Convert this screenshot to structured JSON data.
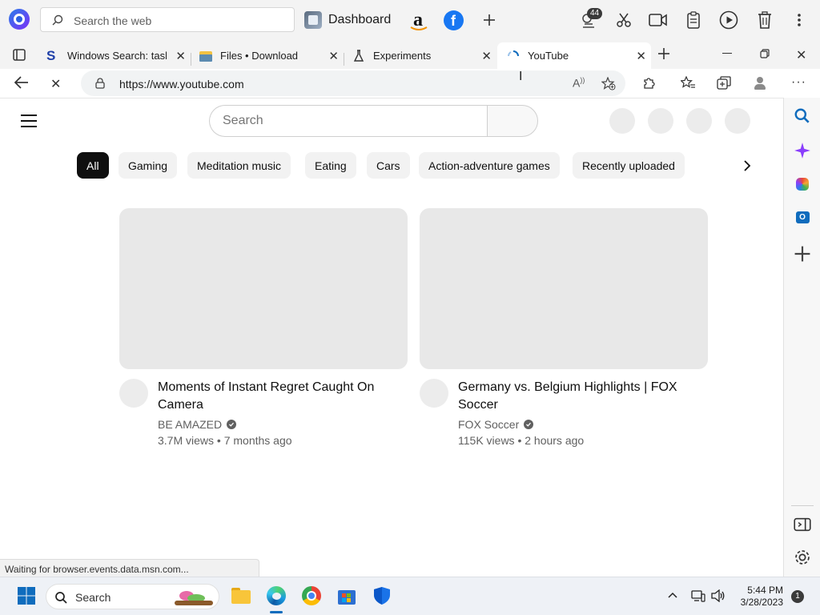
{
  "topbar": {
    "search_placeholder": "Search the web",
    "dashboard_label": "Dashboard",
    "weather_badge": "44"
  },
  "tabs": [
    {
      "title": "Windows Search: tasksp",
      "icon": "s-logo-icon"
    },
    {
      "title": "Files • Download",
      "icon": "folder-icon"
    },
    {
      "title": "Experiments",
      "icon": "flask-icon"
    },
    {
      "title": "YouTube",
      "icon": "loading-spinner-icon",
      "active": true
    }
  ],
  "address": {
    "url": "https://www.youtube.com"
  },
  "youtube": {
    "search_placeholder": "Search",
    "chips": [
      "All",
      "Gaming",
      "Meditation music",
      "Eating",
      "Cars",
      "Action-adventure games",
      "Recently uploaded"
    ],
    "videos": [
      {
        "title": "Moments of Instant Regret Caught On Camera",
        "channel": "BE AMAZED",
        "meta": "3.7M views • 7 months ago"
      },
      {
        "title": "Germany vs. Belgium Highlights | FOX Soccer",
        "channel": "FOX Soccer",
        "meta": "115K views • 2 hours ago"
      }
    ]
  },
  "status_text": "Waiting for browser.events.data.msn.com...",
  "taskbar": {
    "search_placeholder": "Search",
    "time": "5:44 PM",
    "date": "3/28/2023",
    "notification_count": "1"
  },
  "colors": {
    "youtube_text": "#0f0f0f",
    "youtube_secondary": "#606060",
    "chip_bg": "#f2f2f2",
    "edge_blue": "#0f6cbd"
  }
}
